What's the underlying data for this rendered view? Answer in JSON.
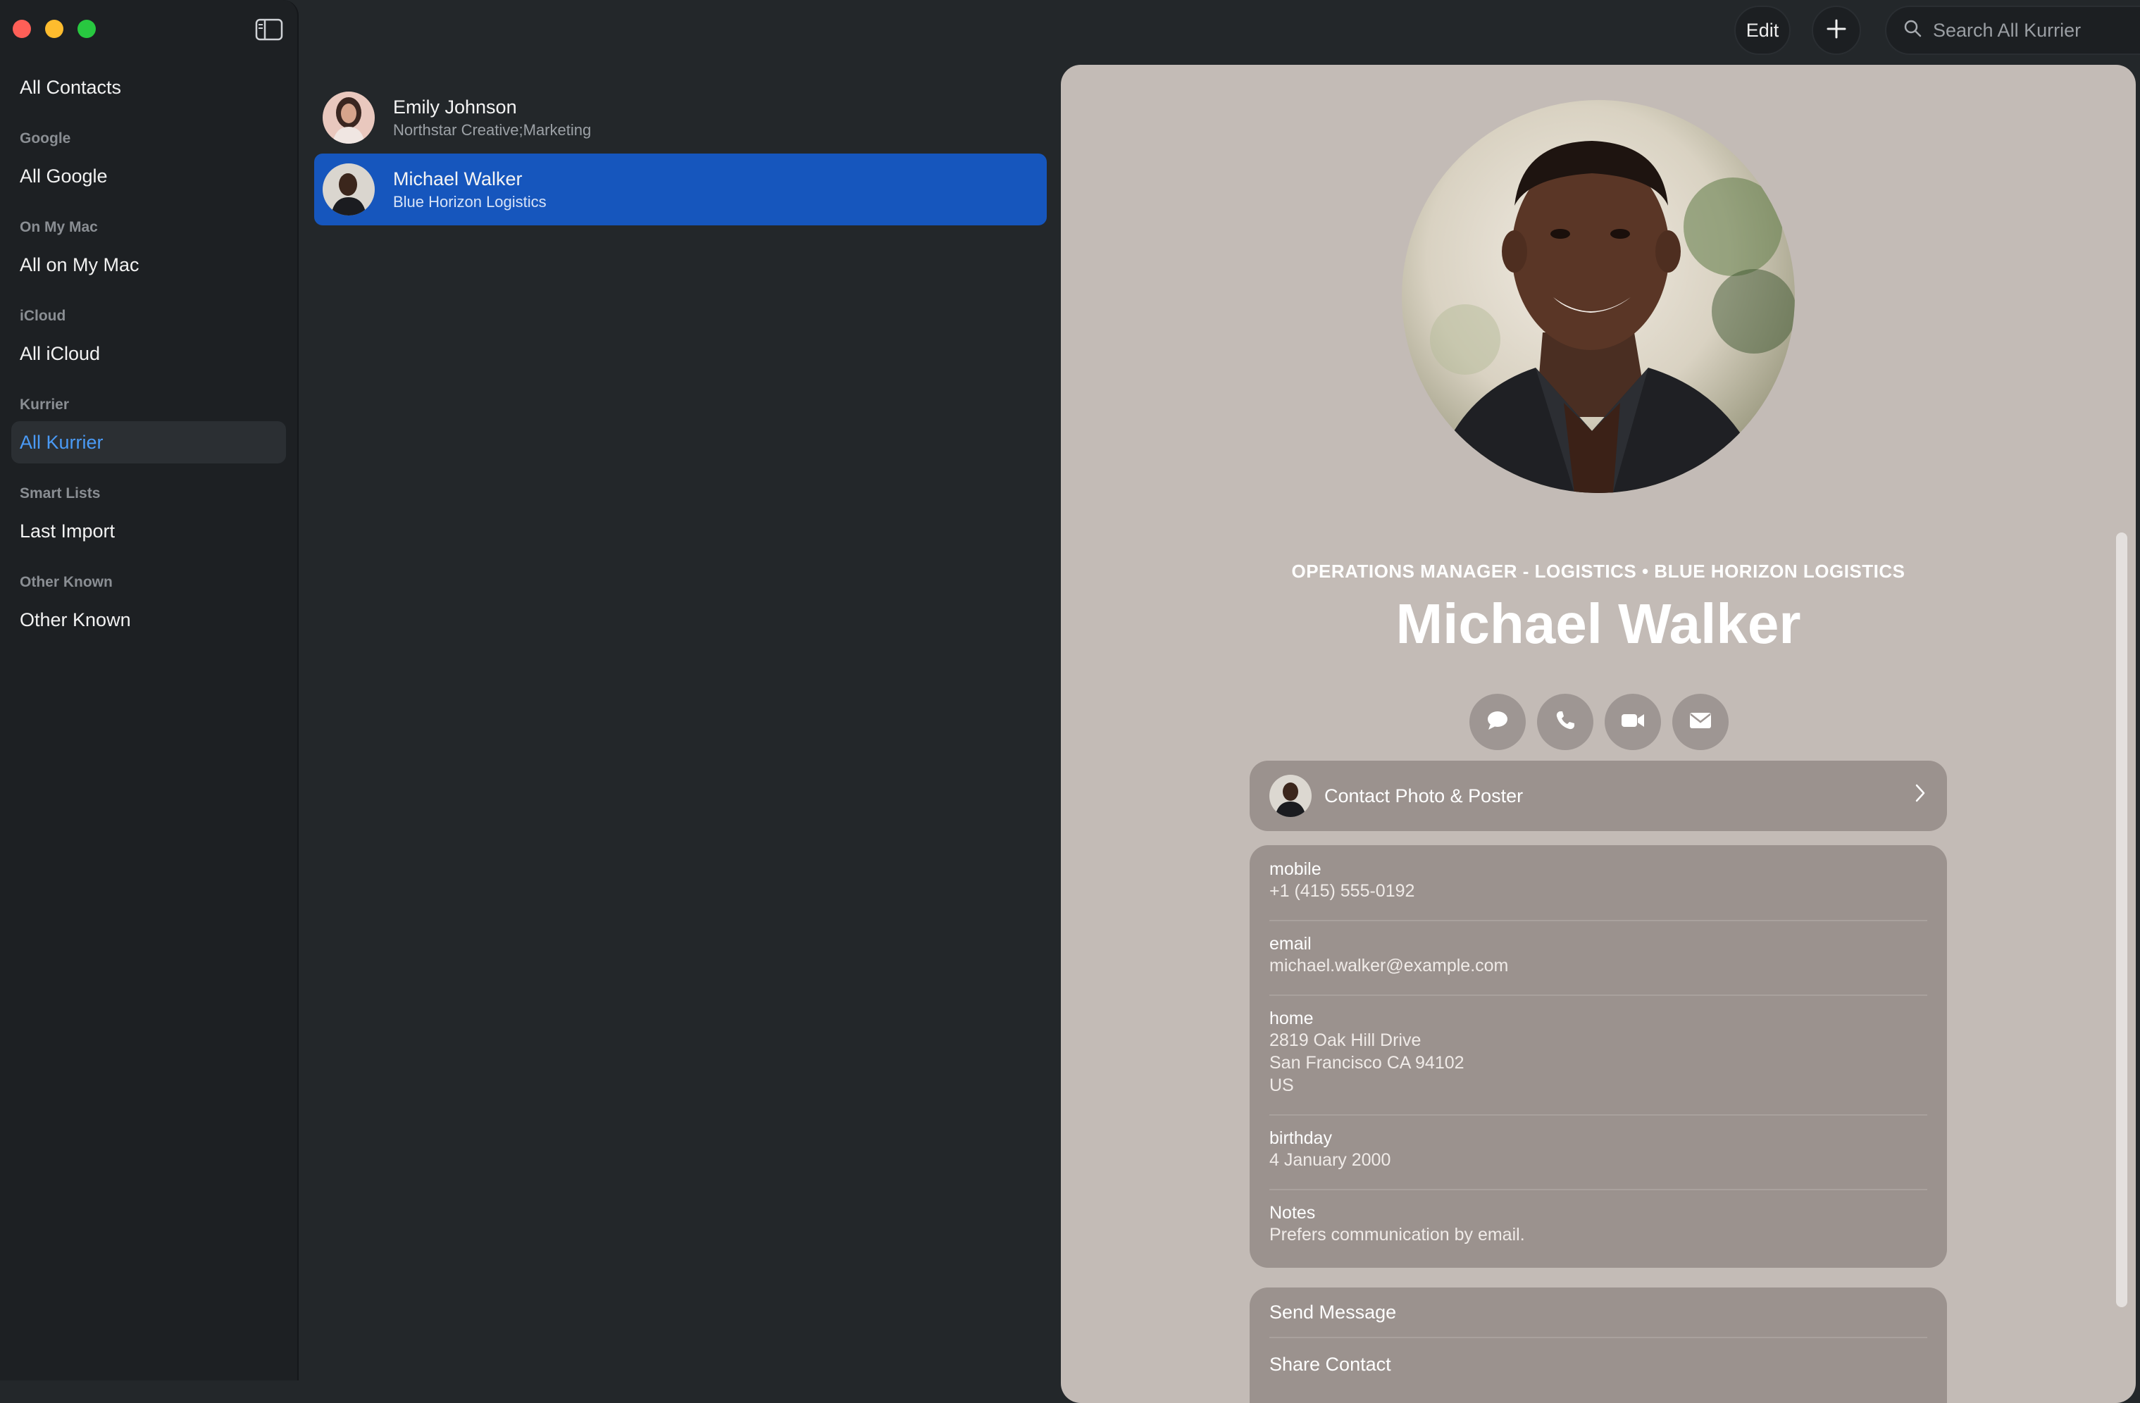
{
  "sidebar": {
    "items": [
      {
        "label": "All Contacts"
      },
      {
        "group": "Google",
        "label": "All Google"
      },
      {
        "group": "On My Mac",
        "label": "All on My Mac"
      },
      {
        "group": "iCloud",
        "label": "All iCloud"
      },
      {
        "group": "Kurrier",
        "label": "All Kurrier",
        "selected": true
      },
      {
        "group": "Smart Lists",
        "label": "Last Import"
      },
      {
        "group": "Other Known",
        "label": "Other Known"
      }
    ],
    "accent": "#4a9af5"
  },
  "toolbar": {
    "edit_label": "Edit",
    "search_placeholder": "Search All Kurrier"
  },
  "contacts": [
    {
      "name": "Emily Johnson",
      "subtitle": "Northstar Creative;Marketing"
    },
    {
      "name": "Michael Walker",
      "subtitle": "Blue Horizon Logistics",
      "selected": true
    }
  ],
  "detail": {
    "header_line": "OPERATIONS MANAGER - LOGISTICS • BLUE HORIZON LOGISTICS",
    "name": "Michael Walker",
    "action_icons": [
      "message-icon",
      "phone-icon",
      "video-icon",
      "mail-icon"
    ],
    "photo_poster_label": "Contact Photo & Poster",
    "fields": {
      "mobile": {
        "label": "mobile",
        "value": "+1 (415) 555-0192"
      },
      "email": {
        "label": "email",
        "value": "michael.walker@example.com"
      },
      "home": {
        "label": "home",
        "line1": "2819 Oak Hill Drive",
        "line2": "San Francisco CA 94102",
        "line3": "US"
      },
      "birthday": {
        "label": "birthday",
        "value": "4 January 2000"
      },
      "notes": {
        "label": "Notes",
        "value": "Prefers communication by email."
      }
    },
    "actions": {
      "send_message": "Send Message",
      "share_contact": "Share Contact"
    },
    "panel_color": "#c3bbb6",
    "selection_color": "#1656bd"
  }
}
